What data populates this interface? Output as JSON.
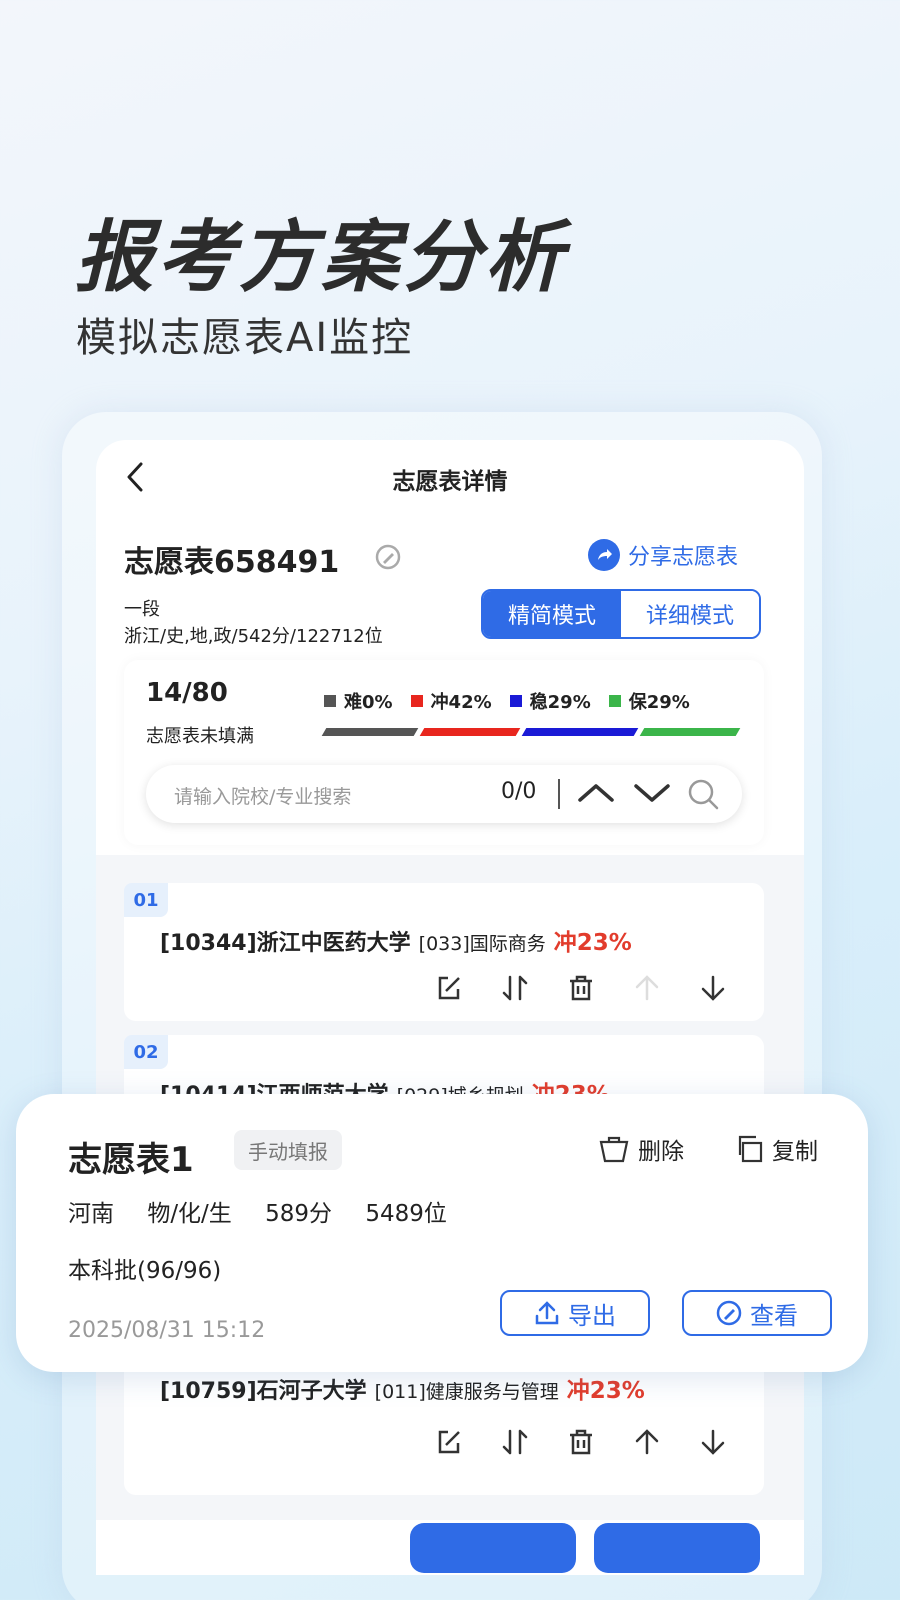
{
  "hero": {
    "title": "报考方案分析",
    "subtitle": "模拟志愿表AI监控"
  },
  "nav": {
    "title": "志愿表详情"
  },
  "info": {
    "table_name": "志愿表658491",
    "share_label": "分享志愿表",
    "batch": "一段",
    "detail": "浙江/史,地,政/542分/122712位",
    "mode_simple": "精简模式",
    "mode_detail": "详细模式"
  },
  "stats": {
    "count": "14/80",
    "note": "志愿表未填满",
    "legend": [
      {
        "label": "难0%",
        "color": "#555555"
      },
      {
        "label": "冲42%",
        "color": "#e8261e"
      },
      {
        "label": "稳29%",
        "color": "#1a1ad6"
      },
      {
        "label": "保29%",
        "color": "#3bb54a"
      }
    ]
  },
  "search": {
    "placeholder": "请输入院校/专业搜索",
    "counter": "0/0"
  },
  "entries": [
    {
      "num": "01",
      "school": "[10344]浙江中医药大学",
      "major": "[033]国际商务",
      "tag": "冲23%"
    },
    {
      "num": "02",
      "school": "[10414]江西师范大学",
      "major": "[029]城乡规划",
      "tag": "冲23%"
    },
    {
      "school": "[10759]石河子大学",
      "major": "[011]健康服务与管理",
      "tag": "冲23%"
    }
  ],
  "popup": {
    "name": "志愿表1",
    "badge": "手动填报",
    "delete_label": "删除",
    "copy_label": "复制",
    "province": "河南",
    "subjects": "物/化/生",
    "score": "589分",
    "rank": "5489位",
    "batch": "本科批(96/96)",
    "date": "2025/08/31 15:12",
    "export_label": "导出",
    "view_label": "查看"
  }
}
